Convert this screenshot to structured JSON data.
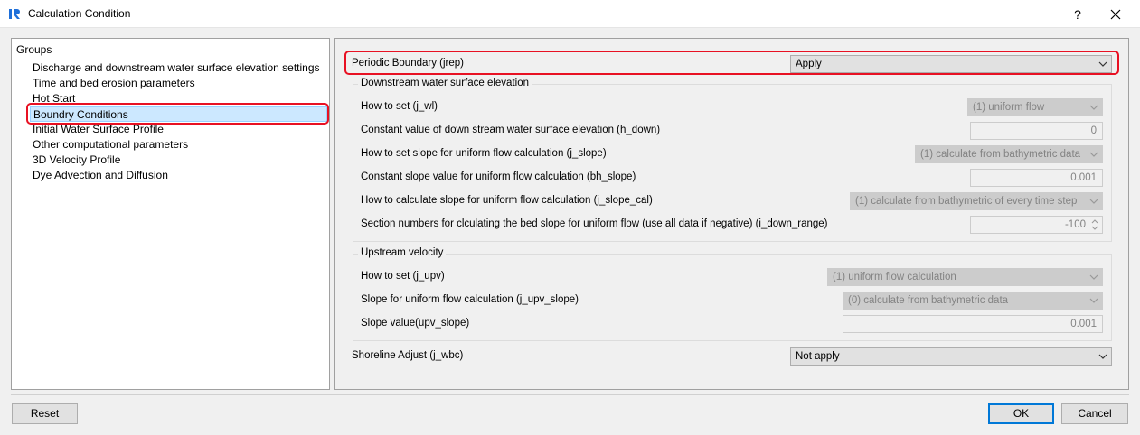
{
  "window": {
    "title": "Calculation Condition",
    "help_label": "?",
    "icon": "iric-app-icon"
  },
  "groups": {
    "title": "Groups",
    "items": [
      {
        "label": "Discharge and downstream water surface elevation settings"
      },
      {
        "label": "Time and bed erosion parameters"
      },
      {
        "label": "Hot Start"
      },
      {
        "label": "Boundry Conditions"
      },
      {
        "label": "Initial Water Surface Profile"
      },
      {
        "label": "Other computational parameters"
      },
      {
        "label": "3D Velocity Profile"
      },
      {
        "label": "Dye Advection and Diffusion"
      }
    ],
    "selected_index": 3
  },
  "settings": {
    "periodic_boundary": {
      "label": "Periodic Boundary (jrep)",
      "value": "Apply"
    },
    "downstream": {
      "title": "Downstream water surface elevation",
      "how_to_set": {
        "label": "How to set (j_wl)",
        "value": "(1) uniform flow"
      },
      "h_down": {
        "label": "Constant value of down stream water surface elevation (h_down)",
        "value": "0"
      },
      "j_slope": {
        "label": "How to set slope for uniform flow calculation (j_slope)",
        "value": "(1) calculate from bathymetric data"
      },
      "bh_slope": {
        "label": "Constant slope value for uniform flow calculation (bh_slope)",
        "value": "0.001"
      },
      "j_slope_cal": {
        "label": "How to calculate slope for uniform flow calculation (j_slope_cal)",
        "value": "(1) calculate from bathymetric of every time step"
      },
      "i_down_range": {
        "label": "Section numbers for clculating the bed slope for uniform flow (use all data if negative) (i_down_range)",
        "value": "-100"
      }
    },
    "upstream": {
      "title": "Upstream velocity",
      "how_to_set": {
        "label": "How to set (j_upv)",
        "value": "(1) uniform flow calculation"
      },
      "j_upv_slope": {
        "label": "Slope for uniform flow calculation (j_upv_slope)",
        "value": "(0) calculate from bathymetric data"
      },
      "upv_slope": {
        "label": "Slope value(upv_slope)",
        "value": "0.001"
      }
    },
    "shoreline": {
      "label": "Shoreline Adjust (j_wbc)",
      "value": "Not apply"
    }
  },
  "buttons": {
    "reset": "Reset",
    "ok": "OK",
    "cancel": "Cancel"
  },
  "colors": {
    "highlight": "#e81123",
    "selection": "#cce8ff",
    "default_button_border": "#0078d7"
  }
}
